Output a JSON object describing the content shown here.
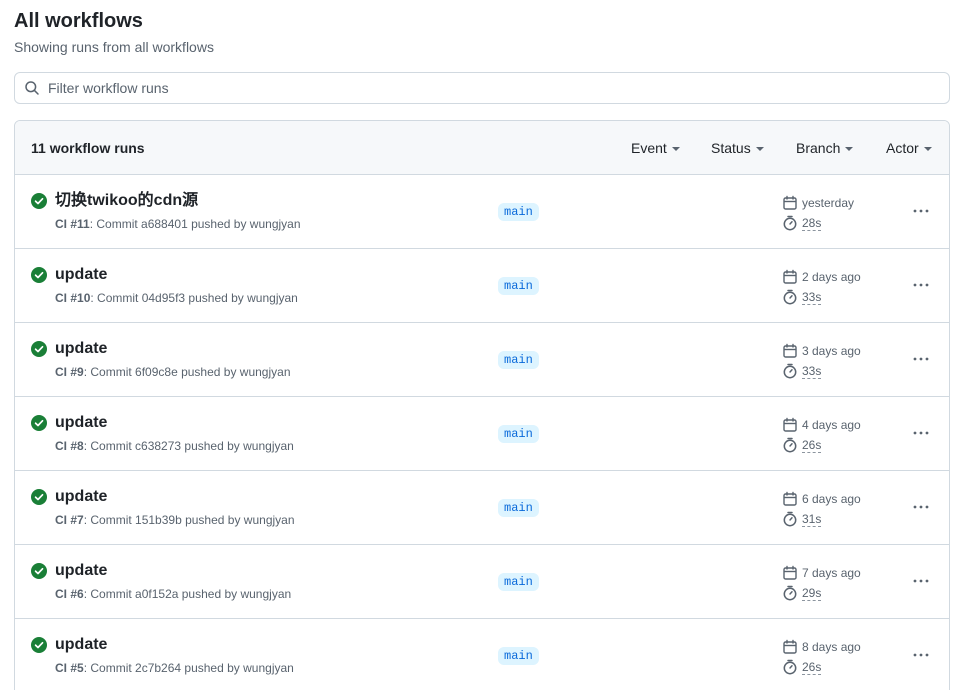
{
  "header": {
    "title": "All workflows",
    "subtitle": "Showing runs from all workflows"
  },
  "filter": {
    "placeholder": "Filter workflow runs",
    "value": ""
  },
  "runs_header": {
    "count_label": "11 workflow runs",
    "filters": [
      {
        "label": "Event"
      },
      {
        "label": "Status"
      },
      {
        "label": "Branch"
      },
      {
        "label": "Actor"
      }
    ]
  },
  "colors": {
    "success": "#1a7f37",
    "branch_bg": "#ddf4ff",
    "branch_fg": "#0969da",
    "muted": "#59636e"
  },
  "runs": [
    {
      "title": "切换twikoo的cdn源",
      "workflow": "CI",
      "number": "#11",
      "detail": ": Commit a688401 pushed by wungjyan",
      "branch": "main",
      "date": "yesterday",
      "duration": "28s"
    },
    {
      "title": "update",
      "workflow": "CI",
      "number": "#10",
      "detail": ": Commit 04d95f3 pushed by wungjyan",
      "branch": "main",
      "date": "2 days ago",
      "duration": "33s"
    },
    {
      "title": "update",
      "workflow": "CI",
      "number": "#9",
      "detail": ": Commit 6f09c8e pushed by wungjyan",
      "branch": "main",
      "date": "3 days ago",
      "duration": "33s"
    },
    {
      "title": "update",
      "workflow": "CI",
      "number": "#8",
      "detail": ": Commit c638273 pushed by wungjyan",
      "branch": "main",
      "date": "4 days ago",
      "duration": "26s"
    },
    {
      "title": "update",
      "workflow": "CI",
      "number": "#7",
      "detail": ": Commit 151b39b pushed by wungjyan",
      "branch": "main",
      "date": "6 days ago",
      "duration": "31s"
    },
    {
      "title": "update",
      "workflow": "CI",
      "number": "#6",
      "detail": ": Commit a0f152a pushed by wungjyan",
      "branch": "main",
      "date": "7 days ago",
      "duration": "29s"
    },
    {
      "title": "update",
      "workflow": "CI",
      "number": "#5",
      "detail": ": Commit 2c7b264 pushed by wungjyan",
      "branch": "main",
      "date": "8 days ago",
      "duration": "26s"
    }
  ]
}
